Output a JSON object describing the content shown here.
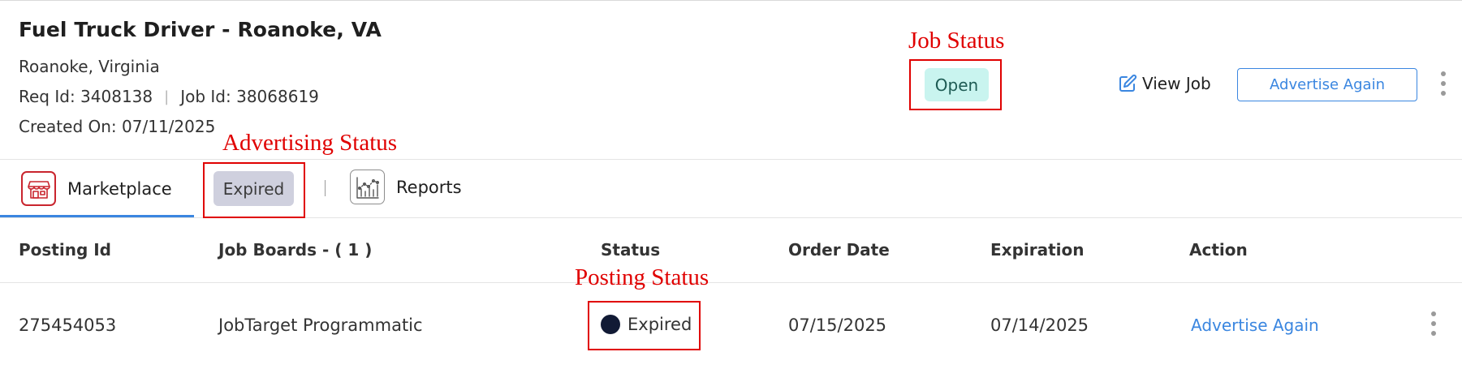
{
  "job": {
    "title": "Fuel Truck Driver - Roanoke, VA",
    "location": "Roanoke, Virginia",
    "req_id_label": "Req Id:",
    "req_id": "3408138",
    "separator": "|",
    "job_id_label": "Job Id:",
    "job_id": "38068619",
    "created_label": "Created On:",
    "created_date": "07/11/2025",
    "status": "Open"
  },
  "header_actions": {
    "view_job": "View Job",
    "advertise_again": "Advertise Again"
  },
  "tabs": {
    "marketplace": "Marketplace",
    "advertising_status": "Expired",
    "separator": "|",
    "reports": "Reports"
  },
  "table": {
    "headers": [
      "Posting Id",
      "Job Boards - ( 1 )",
      "Status",
      "Order Date",
      "Expiration",
      "Action"
    ],
    "rows": [
      {
        "posting_id": "275454053",
        "job_board": "JobTarget Programmatic",
        "status": "Expired",
        "order_date": "07/15/2025",
        "expiration": "07/14/2025",
        "action": "Advertise Again"
      }
    ]
  },
  "annotations": {
    "job_status": "Job Status",
    "advertising_status": "Advertising Status",
    "posting_status": "Posting Status"
  },
  "colors": {
    "accent_blue": "#3a86e0",
    "open_pill_bg": "#c9f4ef",
    "expired_pill_bg": "#cfd0de",
    "status_dot": "#111a35",
    "annotation_red": "#e00000",
    "store_icon_red": "#c9252e"
  },
  "icons": {
    "view_job": "edit-icon",
    "marketplace": "storefront-icon",
    "reports": "chart-icon",
    "more": "kebab-menu-icon"
  }
}
